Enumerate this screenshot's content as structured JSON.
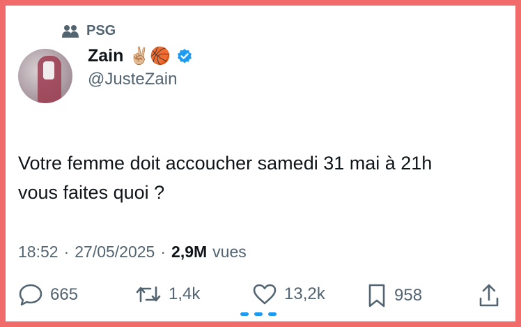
{
  "community": {
    "label": "PSG",
    "icon": "people-icon"
  },
  "author": {
    "name": "Zain",
    "emoji": "✌🏼🏀",
    "verified": true,
    "handle": "@JusteZain"
  },
  "tweet": {
    "text_line1": "Votre femme doit accoucher samedi 31 mai à 21h",
    "text_line2": "vous faites quoi ?"
  },
  "meta": {
    "time": "18:52",
    "sep1": "·",
    "date": "27/05/2025",
    "sep2": "·",
    "views_count": "2,9M",
    "views_label": "vues"
  },
  "actions": {
    "replies": "665",
    "reposts": "1,4k",
    "likes": "13,2k",
    "bookmarks": "958"
  },
  "colors": {
    "border": "#f26b6b",
    "verified": "#1d9bf0",
    "secondary_text": "#536471",
    "primary_text": "#0f1419"
  }
}
